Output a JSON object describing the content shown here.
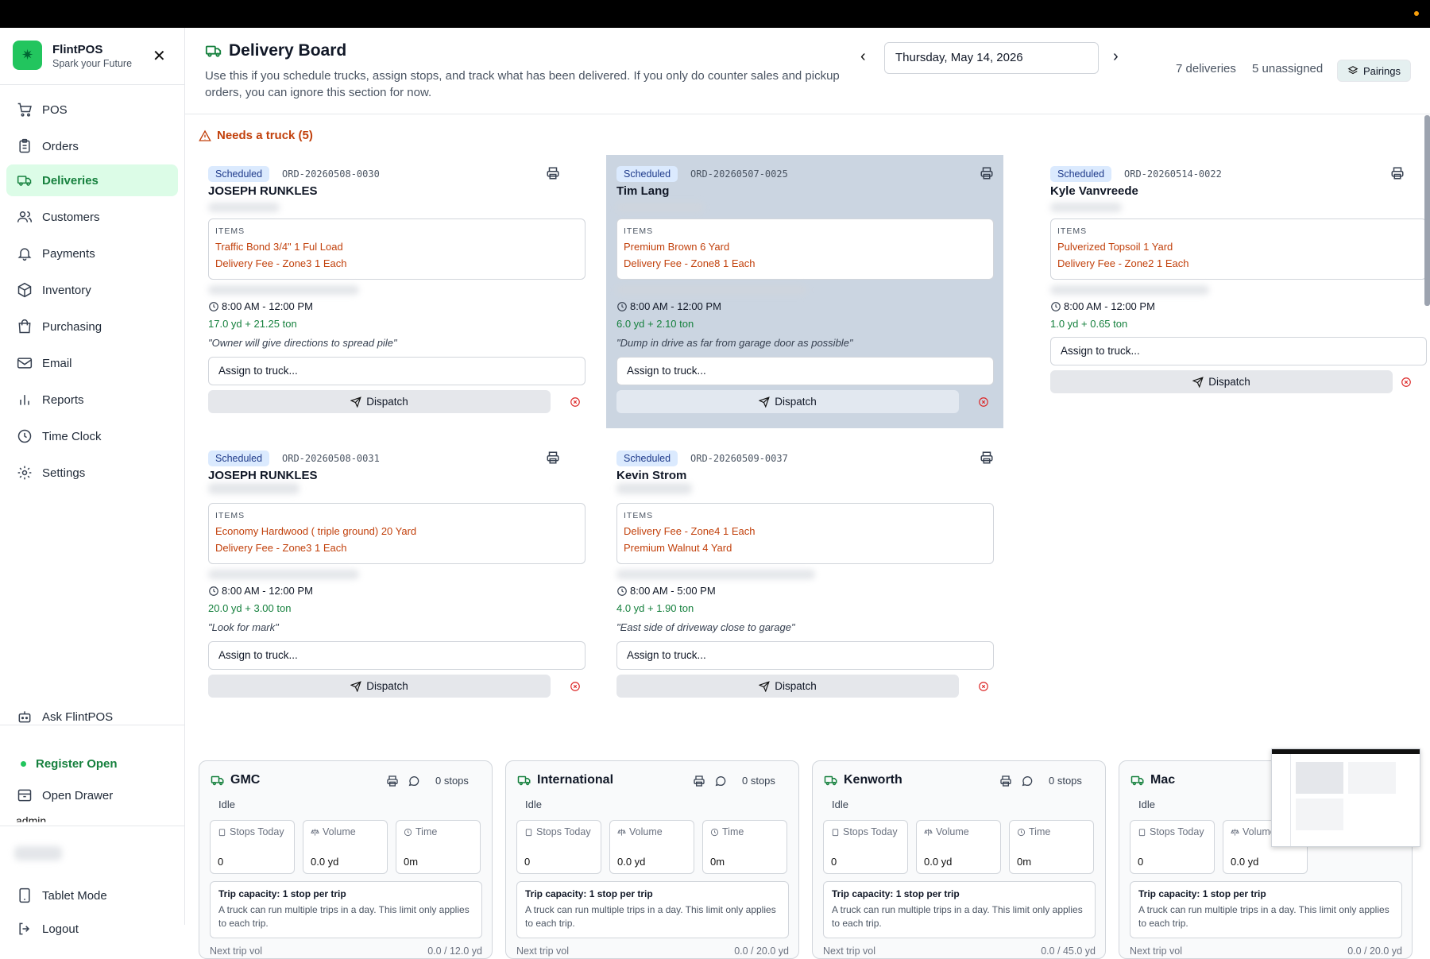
{
  "app": {
    "name": "FlintPOS",
    "tagline": "Spark your Future",
    "brand_color": "#22c55e"
  },
  "sidebar": {
    "items": [
      {
        "label": "POS",
        "icon": "cart-icon"
      },
      {
        "label": "Orders",
        "icon": "clipboard-icon"
      },
      {
        "label": "Deliveries",
        "icon": "truck-icon",
        "active": true
      },
      {
        "label": "Customers",
        "icon": "users-icon"
      },
      {
        "label": "Payments",
        "icon": "bell-icon"
      },
      {
        "label": "Inventory",
        "icon": "box-icon"
      },
      {
        "label": "Purchasing",
        "icon": "bag-icon"
      },
      {
        "label": "Email",
        "icon": "mail-icon"
      },
      {
        "label": "Reports",
        "icon": "bar-chart-icon"
      },
      {
        "label": "Time Clock",
        "icon": "clock-icon"
      },
      {
        "label": "Settings",
        "icon": "gear-icon"
      }
    ],
    "ask": "Ask FlintPOS",
    "register_status": "Register Open",
    "open_drawer": "Open Drawer",
    "user": "admin",
    "tablet_mode": "Tablet Mode",
    "logout": "Logout"
  },
  "header": {
    "title": "Delivery Board",
    "subtitle": "Use this if you schedule trucks, assign stops, and track what has been delivered. If you only do counter sales and pickup orders, you can ignore this section for now.",
    "date": "Thursday, May 14, 2026",
    "deliveries": "7 deliveries",
    "unassigned": "5 unassigned",
    "pairings": "Pairings"
  },
  "section": {
    "needs_truck": "Needs a truck (5)"
  },
  "labels": {
    "items": "ITEMS",
    "assign": "Assign to truck...",
    "dispatch": "Dispatch"
  },
  "deliveries": [
    {
      "status": "Scheduled",
      "order": "ORD-20260508-0030",
      "customer": "JOSEPH RUNKLES",
      "items": [
        "Traffic Bond 3/4\" 1 Ful Load",
        "Delivery Fee - Zone3 1 Each"
      ],
      "time": "8:00 AM - 12:00 PM",
      "volume": "17.0 yd + 21.25 ton",
      "note": "\"Owner will give directions to spread pile\""
    },
    {
      "status": "Scheduled",
      "order": "ORD-20260507-0025",
      "customer": "Tim Lang",
      "items": [
        "Premium Brown 6 Yard",
        "Delivery Fee - Zone8 1 Each"
      ],
      "time": "8:00 AM - 12:00 PM",
      "volume": "6.0 yd + 2.10 ton",
      "note": "\"Dump in drive as far from garage door as possible\"",
      "selected": true
    },
    {
      "status": "Scheduled",
      "order": "ORD-20260514-0022",
      "customer": "Kyle Vanvreede",
      "items": [
        "Pulverized Topsoil 1 Yard",
        "Delivery Fee - Zone2 1 Each"
      ],
      "time": "8:00 AM - 12:00 PM",
      "volume": "1.0 yd + 0.65 ton",
      "note": ""
    },
    {
      "status": "Scheduled",
      "order": "ORD-20260508-0031",
      "customer": "JOSEPH RUNKLES",
      "items": [
        "Economy Hardwood ( triple ground) 20 Yard",
        "Delivery Fee - Zone3 1 Each"
      ],
      "time": "8:00 AM - 12:00 PM",
      "volume": "20.0 yd + 3.00 ton",
      "note": "\"Look for mark\""
    },
    {
      "status": "Scheduled",
      "order": "ORD-20260509-0037",
      "customer": "Kevin Strom",
      "items": [
        "Delivery Fee - Zone4 1 Each",
        "Premium Walnut 4 Yard"
      ],
      "time": "8:00 AM - 5:00 PM",
      "volume": "4.0 yd + 1.90 ton",
      "note": "\"East side of driveway close to garage\""
    }
  ],
  "truck_labels": {
    "idle": "Idle",
    "stops_today": "Stops Today",
    "volume": "Volume",
    "time": "Time",
    "cap_title": "Trip capacity: 1 stop per trip",
    "cap_desc": "A truck can run multiple trips in a day. This limit only applies to each trip.",
    "next_trip": "Next trip vol"
  },
  "trucks": [
    {
      "name": "GMC",
      "stops": "0 stops",
      "stops_today": "0",
      "volume": "0.0 yd",
      "time": "0m",
      "next": "0.0 / 12.0 yd"
    },
    {
      "name": "International",
      "stops": "0 stops",
      "stops_today": "0",
      "volume": "0.0 yd",
      "time": "0m",
      "next": "0.0 / 20.0 yd"
    },
    {
      "name": "Kenworth",
      "stops": "0 stops",
      "stops_today": "0",
      "volume": "0.0 yd",
      "time": "0m",
      "next": "0.0 / 45.0 yd"
    },
    {
      "name": "Mac",
      "stops": "",
      "stops_today": "0",
      "volume": "0.0 yd",
      "time": "",
      "next": "0.0 / 20.0 yd"
    }
  ]
}
